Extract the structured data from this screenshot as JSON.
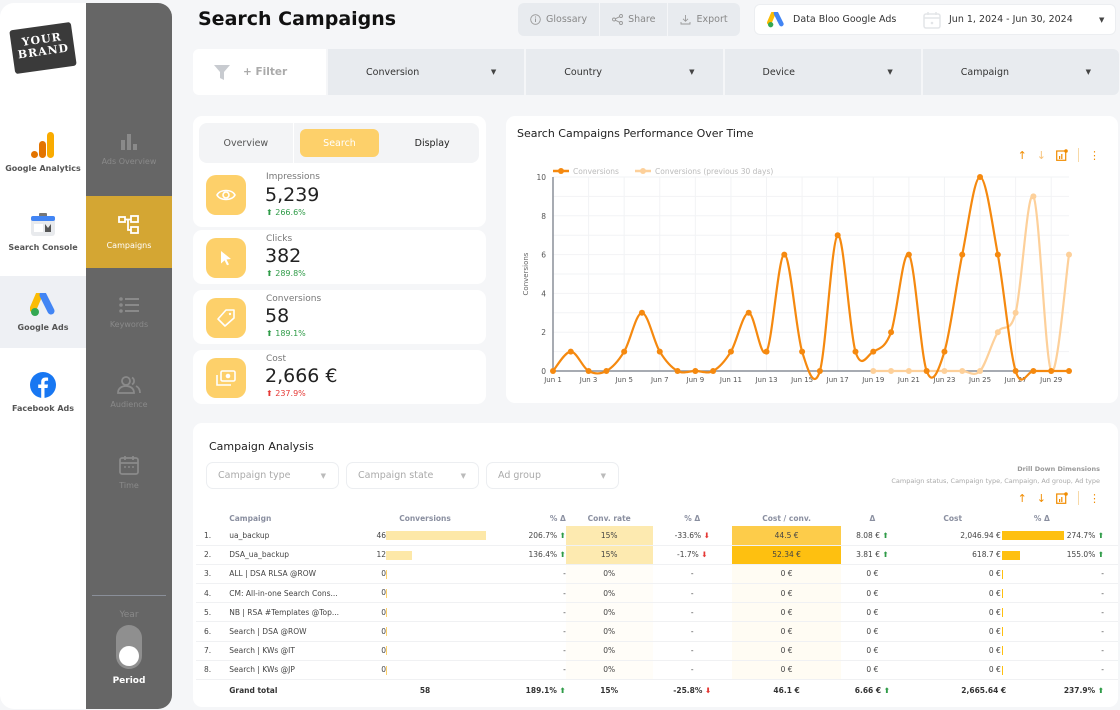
{
  "brand": {
    "line1": "YOUR",
    "line2": "BRAND"
  },
  "sources": [
    {
      "label": "Google Analytics",
      "icon": "google-analytics-icon",
      "active": false
    },
    {
      "label": "Search Console",
      "icon": "search-console-icon",
      "active": false
    },
    {
      "label": "Google Ads",
      "icon": "google-ads-icon",
      "active": true
    },
    {
      "label": "Facebook Ads",
      "icon": "facebook-icon",
      "active": false
    }
  ],
  "nav": [
    {
      "label": "Ads Overview",
      "icon": "bar-chart-icon",
      "active": false
    },
    {
      "label": "Campaigns",
      "icon": "hierarchy-icon",
      "active": true
    },
    {
      "label": "Keywords",
      "icon": "list-icon",
      "active": false
    },
    {
      "label": "Audience",
      "icon": "users-icon",
      "active": false
    },
    {
      "label": "Time",
      "icon": "calendar-icon",
      "active": false
    }
  ],
  "toggle": {
    "off_label": "Year",
    "on_label": "Period",
    "state": "Period"
  },
  "header": {
    "title": "Search Campaigns",
    "actions": {
      "glossary": "Glossary",
      "share": "Share",
      "export": "Export"
    },
    "data_source": "Data Bloo Google Ads",
    "date_range": "Jun 1, 2024 - Jun 30, 2024"
  },
  "filters": {
    "add_label": "+ Filter",
    "dropdowns": [
      "Conversion",
      "Country",
      "Device",
      "Campaign"
    ]
  },
  "tabs": [
    {
      "label": "Overview",
      "active": false
    },
    {
      "label": "Search",
      "active": true
    },
    {
      "label": "Display",
      "active": false
    }
  ],
  "kpis": [
    {
      "label": "Impressions",
      "value": "5,239",
      "delta": "266.6%",
      "direction": "up"
    },
    {
      "label": "Clicks",
      "value": "382",
      "delta": "289.8%",
      "direction": "up"
    },
    {
      "label": "Conversions",
      "value": "58",
      "delta": "189.1%",
      "direction": "up"
    },
    {
      "label": "Cost",
      "value": "2,666 €",
      "delta": "237.9%",
      "direction": "up-bad"
    }
  ],
  "chart_data": {
    "type": "line",
    "title": "Search Campaigns Performance Over Time",
    "xlabel": "",
    "ylabel": "Conversions",
    "ylim": [
      0,
      10
    ],
    "yticks": [
      0,
      2,
      4,
      6,
      8,
      10
    ],
    "x": [
      "Jun 1",
      "Jun 2",
      "Jun 3",
      "Jun 4",
      "Jun 5",
      "Jun 6",
      "Jun 7",
      "Jun 8",
      "Jun 9",
      "Jun 10",
      "Jun 11",
      "Jun 12",
      "Jun 13",
      "Jun 14",
      "Jun 15",
      "Jun 16",
      "Jun 17",
      "Jun 18",
      "Jun 19",
      "Jun 20",
      "Jun 21",
      "Jun 22",
      "Jun 23",
      "Jun 24",
      "Jun 25",
      "Jun 26",
      "Jun 27",
      "Jun 28",
      "Jun 29",
      "Jun 30"
    ],
    "xticks": [
      "Jun 1",
      "Jun 3",
      "Jun 5",
      "Jun 7",
      "Jun 9",
      "Jun 11",
      "Jun 13",
      "Jun 15",
      "Jun 17",
      "Jun 19",
      "Jun 21",
      "Jun 23",
      "Jun 25",
      "Jun 27",
      "Jun 29"
    ],
    "legend": "top-left",
    "grid": true,
    "series": [
      {
        "name": "Conversions",
        "color": "#f5890f",
        "values": [
          0,
          1,
          0,
          0,
          1,
          3,
          1,
          0,
          0,
          0,
          1,
          3,
          1,
          6,
          1,
          0,
          7,
          1,
          1,
          2,
          6,
          0,
          1,
          6,
          10,
          6,
          0,
          0,
          0,
          0
        ]
      },
      {
        "name": "Conversions (previous 30 days)",
        "color": "#fdd09a",
        "values": [
          null,
          null,
          null,
          null,
          null,
          null,
          null,
          null,
          0,
          null,
          null,
          null,
          null,
          null,
          null,
          null,
          null,
          null,
          0,
          0,
          0,
          0,
          0,
          0,
          0,
          2,
          3,
          9,
          0,
          6
        ]
      }
    ]
  },
  "analysis": {
    "title": "Campaign Analysis",
    "dropdowns": [
      "Campaign type",
      "Campaign state",
      "Ad group"
    ],
    "drill_title": "Drill Down Dimensions",
    "drill_sub": "Campaign status, Campaign type, Campaign, Ad group, Ad type",
    "columns": [
      "Campaign",
      "Conversions",
      "% Δ",
      "Conv. rate",
      "% Δ",
      "Cost / conv.",
      "Δ",
      "Cost",
      "% Δ"
    ],
    "rows": [
      {
        "n": "1.",
        "campaign": "ua_backup",
        "conv": "46",
        "conv_frac": 1.0,
        "conv_d": "206.7%",
        "conv_dd": "up",
        "rate": "15%",
        "rate_d": "-33.6%",
        "rate_dd": "down",
        "cpc": "44.5 €",
        "cpc_level": 0.85,
        "cpc_d": "8.08 €",
        "cpc_dd": "up",
        "cost": "2,046.94 €",
        "cost_frac": 1.0,
        "cost_d": "274.7%",
        "cost_dd": "up"
      },
      {
        "n": "2.",
        "campaign": "DSA_ua_backup",
        "conv": "12",
        "conv_frac": 0.26,
        "conv_d": "136.4%",
        "conv_dd": "up",
        "rate": "15%",
        "rate_d": "-1.7%",
        "rate_dd": "down",
        "cpc": "52.34 €",
        "cpc_level": 1.0,
        "cpc_d": "3.81 €",
        "cpc_dd": "up",
        "cost": "618.7 €",
        "cost_frac": 0.3,
        "cost_d": "155.0%",
        "cost_dd": "up"
      },
      {
        "n": "3.",
        "campaign": "ALL | DSA RLSA @ROW",
        "conv": "0",
        "conv_frac": 0,
        "conv_d": "-",
        "conv_dd": "",
        "rate": "0%",
        "rate_d": "-",
        "rate_dd": "",
        "cpc": "0 €",
        "cpc_level": 0,
        "cpc_d": "0 €",
        "cpc_dd": "",
        "cost": "0 €",
        "cost_frac": 0,
        "cost_d": "-",
        "cost_dd": ""
      },
      {
        "n": "4.",
        "campaign": "CM: All-in-one Search Cons...",
        "conv": "0",
        "conv_frac": 0,
        "conv_d": "-",
        "conv_dd": "",
        "rate": "0%",
        "rate_d": "-",
        "rate_dd": "",
        "cpc": "0 €",
        "cpc_level": 0,
        "cpc_d": "0 €",
        "cpc_dd": "",
        "cost": "0 €",
        "cost_frac": 0,
        "cost_d": "-",
        "cost_dd": ""
      },
      {
        "n": "5.",
        "campaign": "NB | RSA #Templates @Top...",
        "conv": "0",
        "conv_frac": 0,
        "conv_d": "-",
        "conv_dd": "",
        "rate": "0%",
        "rate_d": "-",
        "rate_dd": "",
        "cpc": "0 €",
        "cpc_level": 0,
        "cpc_d": "0 €",
        "cpc_dd": "",
        "cost": "0 €",
        "cost_frac": 0,
        "cost_d": "-",
        "cost_dd": ""
      },
      {
        "n": "6.",
        "campaign": "Search | DSA @ROW",
        "conv": "0",
        "conv_frac": 0,
        "conv_d": "-",
        "conv_dd": "",
        "rate": "0%",
        "rate_d": "-",
        "rate_dd": "",
        "cpc": "0 €",
        "cpc_level": 0,
        "cpc_d": "0 €",
        "cpc_dd": "",
        "cost": "0 €",
        "cost_frac": 0,
        "cost_d": "-",
        "cost_dd": ""
      },
      {
        "n": "7.",
        "campaign": "Search | KWs @IT",
        "conv": "0",
        "conv_frac": 0,
        "conv_d": "-",
        "conv_dd": "",
        "rate": "0%",
        "rate_d": "-",
        "rate_dd": "",
        "cpc": "0 €",
        "cpc_level": 0,
        "cpc_d": "0 €",
        "cpc_dd": "",
        "cost": "0 €",
        "cost_frac": 0,
        "cost_d": "-",
        "cost_dd": ""
      },
      {
        "n": "8.",
        "campaign": "Search | KWs @JP",
        "conv": "0",
        "conv_frac": 0,
        "conv_d": "-",
        "conv_dd": "",
        "rate": "0%",
        "rate_d": "-",
        "rate_dd": "",
        "cpc": "0 €",
        "cpc_level": 0,
        "cpc_d": "0 €",
        "cpc_dd": "",
        "cost": "0 €",
        "cost_frac": 0,
        "cost_d": "-",
        "cost_dd": ""
      }
    ],
    "total": {
      "label": "Grand total",
      "conv": "58",
      "conv_d": "189.1%",
      "conv_dd": "up",
      "rate": "15%",
      "rate_d": "-25.8%",
      "rate_dd": "down",
      "cpc": "46.1 €",
      "cpc_d": "6.66 €",
      "cpc_dd": "up",
      "cost": "2,665.64 €",
      "cost_d": "237.9%",
      "cost_dd": "up"
    }
  },
  "colors": {
    "accent": "#fdd06a",
    "nav_active": "#d4a633",
    "line": "#f5890f",
    "line_prev": "#fdd09a",
    "up": "#2e9b47",
    "down": "#e53935"
  }
}
